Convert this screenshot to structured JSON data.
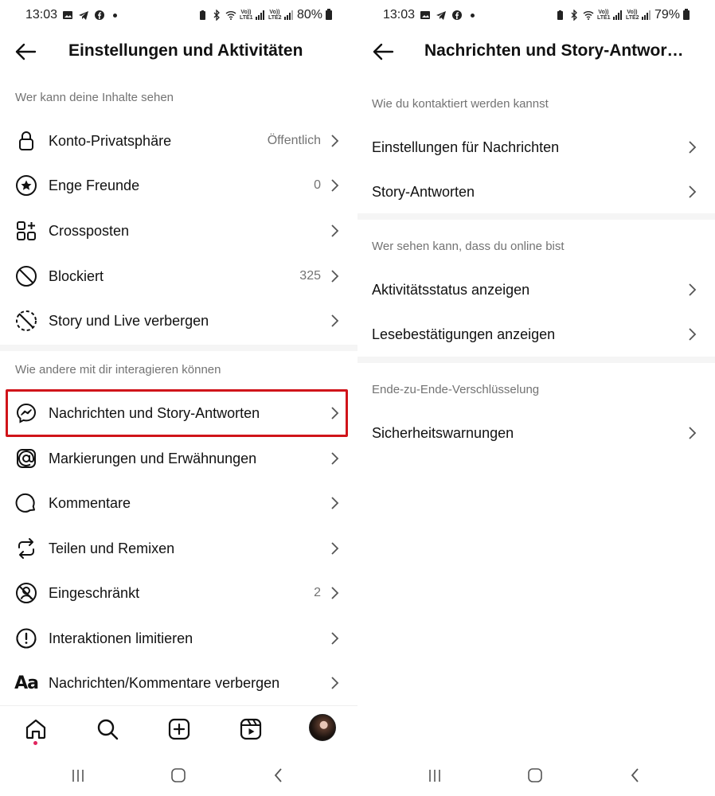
{
  "left": {
    "status": {
      "time": "13:03",
      "battery_text": "80%",
      "net1": "Vo)) LTE1",
      "net2": "Vo)) LTE2"
    },
    "header": {
      "title": "Einstellungen und Aktivitäten"
    },
    "section1": {
      "label": "Wer kann deine Inhalte sehen",
      "items": [
        {
          "label": "Konto-Privatsphäre",
          "value": "Öffentlich",
          "icon": "lock-icon"
        },
        {
          "label": "Enge Freunde",
          "value": "0",
          "icon": "star-circle-icon"
        },
        {
          "label": "Crossposten",
          "value": "",
          "icon": "crosspost-grid-icon"
        },
        {
          "label": "Blockiert",
          "value": "325",
          "icon": "block-icon"
        },
        {
          "label": "Story und Live verbergen",
          "value": "",
          "icon": "hide-story-icon"
        }
      ]
    },
    "section2": {
      "label": "Wie andere mit dir interagieren können",
      "items": [
        {
          "label": "Nachrichten und Story-Antworten",
          "value": "",
          "icon": "messenger-icon",
          "highlighted": true
        },
        {
          "label": "Markierungen und Erwähnungen",
          "value": "",
          "icon": "at-sign-icon"
        },
        {
          "label": "Kommentare",
          "value": "",
          "icon": "comment-icon"
        },
        {
          "label": "Teilen und Remixen",
          "value": "",
          "icon": "remix-icon"
        },
        {
          "label": "Eingeschränkt",
          "value": "2",
          "icon": "restricted-icon"
        },
        {
          "label": "Interaktionen limitieren",
          "value": "",
          "icon": "limit-interactions-icon"
        },
        {
          "label": "Nachrichten/Kommentare verbergen",
          "value": "",
          "icon": "hidden-words-icon",
          "icon_text": "Aa"
        }
      ]
    },
    "highlight_color": "#d0141a"
  },
  "right": {
    "status": {
      "time": "13:03",
      "battery_text": "79%",
      "net1": "Vo)) LTE1",
      "net2": "Vo)) LTE2"
    },
    "header": {
      "title": "Nachrichten und Story-Antwor…"
    },
    "section1": {
      "label": "Wie du kontaktiert werden kannst",
      "items": [
        {
          "label": "Einstellungen für Nachrichten"
        },
        {
          "label": "Story-Antworten"
        }
      ]
    },
    "section2": {
      "label": "Wer sehen kann, dass du online bist",
      "items": [
        {
          "label": "Aktivitätsstatus anzeigen"
        },
        {
          "label": "Lesebestätigungen anzeigen"
        }
      ]
    },
    "section3": {
      "label": "Ende-zu-Ende-Verschlüsselung",
      "items": [
        {
          "label": "Sicherheitswarnungen"
        }
      ]
    }
  },
  "bottom_nav": {
    "items": [
      "home-icon",
      "search-icon",
      "create-post-icon",
      "reels-icon",
      "profile-avatar"
    ],
    "notification_dot_color": "#e0245e"
  }
}
